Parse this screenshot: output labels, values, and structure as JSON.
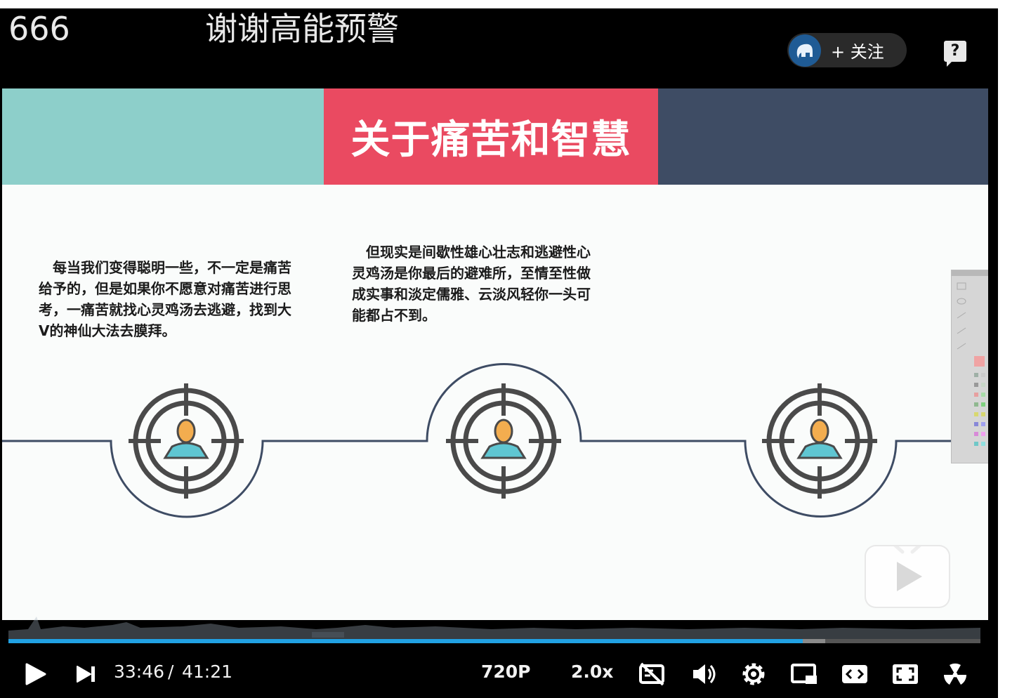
{
  "danmaku": [
    "666",
    "谢谢高能预警"
  ],
  "follow": {
    "label": "+ 关注"
  },
  "help_icon": "?",
  "slide": {
    "title": "关于痛苦和智慧",
    "band_colors": [
      "#8dcfca",
      "#ea4a61",
      "#3e4c64"
    ],
    "paragraph_left": "　每当我们变得聪明一些，不一定是痛苦给予的，但是如果你不愿意对痛苦进行思考，一痛苦就找心灵鸡汤去逃避，找到大V的神仙大法去膜拜。",
    "paragraph_middle": "　但现实是间歇性雄心壮志和逃避性心灵鸡汤是你最后的避难所，至情至性做成实事和淡定儒雅、云淡风轻你一头可能都占不到。"
  },
  "player": {
    "current_time": "33:46",
    "separator": "/",
    "duration": "41:21",
    "progress_fraction": 0.817,
    "buffered_fraction": 0.84,
    "quality": "720P",
    "speed": "2.0x",
    "accent_color": "#21a1e3"
  },
  "icons": [
    "play-icon",
    "next-icon",
    "danmaku-off-icon",
    "volume-icon",
    "settings-icon",
    "pip-icon",
    "widescreen-icon",
    "fullscreen-icon",
    "radiation-icon",
    "tv-watermark-icon",
    "help-icon"
  ]
}
